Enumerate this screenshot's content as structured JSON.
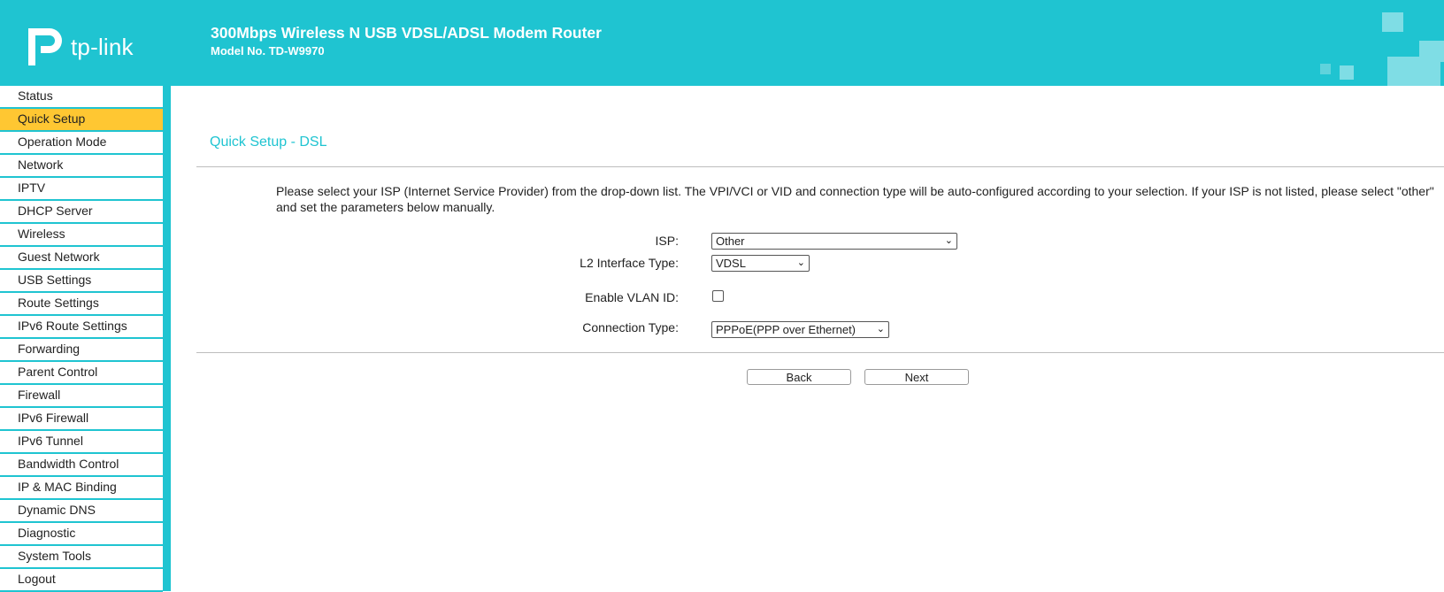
{
  "header": {
    "logo_text": "tp-link",
    "title": "300Mbps Wireless N USB VDSL/ADSL Modem Router",
    "model": "Model No. TD-W9970"
  },
  "sidebar": {
    "items": [
      {
        "label": "Status"
      },
      {
        "label": "Quick Setup",
        "active": true
      },
      {
        "label": "Operation Mode"
      },
      {
        "label": "Network"
      },
      {
        "label": "IPTV"
      },
      {
        "label": "DHCP Server"
      },
      {
        "label": "Wireless"
      },
      {
        "label": "Guest Network"
      },
      {
        "label": "USB Settings"
      },
      {
        "label": "Route Settings"
      },
      {
        "label": "IPv6 Route Settings"
      },
      {
        "label": "Forwarding"
      },
      {
        "label": "Parent Control"
      },
      {
        "label": "Firewall"
      },
      {
        "label": "IPv6 Firewall"
      },
      {
        "label": "IPv6 Tunnel"
      },
      {
        "label": "Bandwidth Control"
      },
      {
        "label": "IP & MAC Binding"
      },
      {
        "label": "Dynamic DNS"
      },
      {
        "label": "Diagnostic"
      },
      {
        "label": "System Tools"
      },
      {
        "label": "Logout"
      }
    ]
  },
  "main": {
    "section_title": "Quick Setup - DSL",
    "description": "Please select your ISP (Internet Service Provider) from the drop-down list. The VPI/VCI or VID and connection type will be auto-configured according to your selection. If your ISP is not listed, please select \"other\" and set the parameters below manually.",
    "form": {
      "isp_label": "ISP:",
      "isp_value": "Other",
      "l2_label": "L2 Interface Type:",
      "l2_value": "VDSL",
      "vlan_label": "Enable VLAN ID:",
      "vlan_checked": false,
      "conn_label": "Connection Type:",
      "conn_value": "PPPoE(PPP over Ethernet)"
    },
    "buttons": {
      "back": "Back",
      "next": "Next"
    }
  },
  "colors": {
    "accent": "#1fc4d1",
    "active_menu": "#ffc732"
  }
}
